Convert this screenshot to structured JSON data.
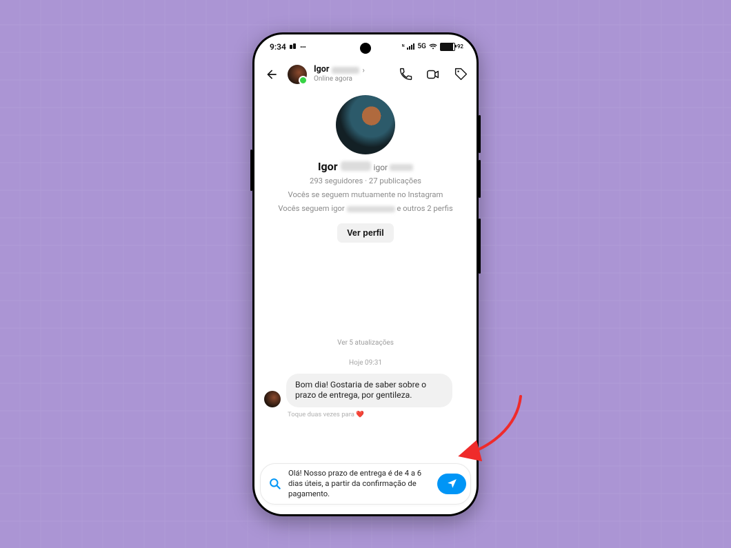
{
  "status": {
    "time": "9:34",
    "network": "5G",
    "battery_text": "92"
  },
  "header": {
    "name": "Igor",
    "status": "Online agora"
  },
  "profile": {
    "name": "Igor",
    "handle_prefix": "igor",
    "stats": "293 seguidores · 27 publicações",
    "mutual1": "Vocês se seguem mutuamente no Instagram",
    "mutual2_pre": "Vocês seguem igor",
    "mutual2_post": "e outros 2 perfis",
    "view_profile": "Ver perfil"
  },
  "thread": {
    "updates": "Ver 5 atualizações",
    "timestamp": "Hoje 09:31",
    "incoming": "Bom dia! Gostaria de saber sobre o prazo de entrega, por gentileza.",
    "tap_hint": "Toque duas vezes para ❤️"
  },
  "composer": {
    "draft": "Olá! Nosso prazo de entrega é de 4 a 6 dias úteis, a partir da confirmação de pagamento."
  }
}
